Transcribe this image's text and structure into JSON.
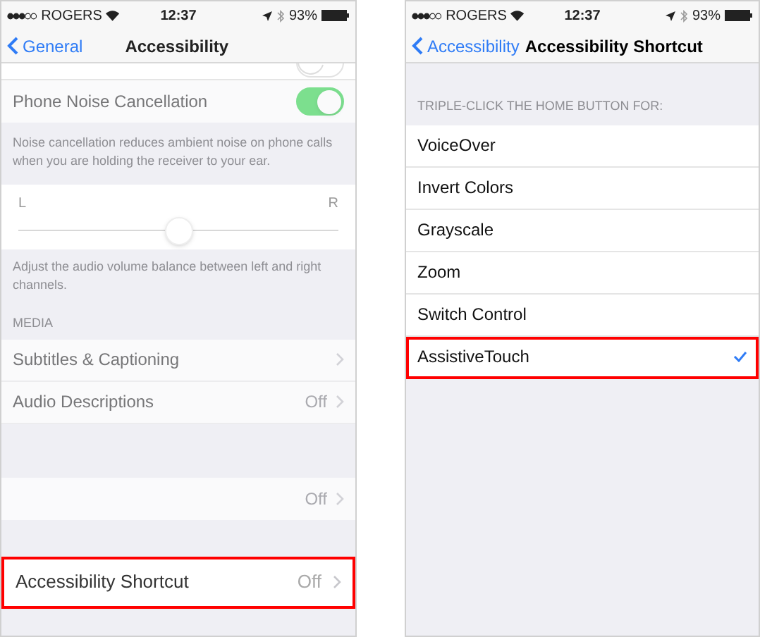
{
  "left_screen": {
    "status_bar": {
      "carrier": "ROGERS",
      "time": "12:37",
      "battery": "93%"
    },
    "nav": {
      "back": "General",
      "title": "Accessibility"
    },
    "cut_row": {
      "on": false
    },
    "noise_row": {
      "label": "Phone Noise Cancellation",
      "on": true
    },
    "noise_footer": "Noise cancellation reduces ambient noise on phone calls when you are holding the receiver to your ear.",
    "balance": {
      "left": "L",
      "right": "R",
      "level": 0.5
    },
    "balance_footer": "Adjust the audio volume balance between left and right channels.",
    "media_header": "MEDIA",
    "media_rows": [
      {
        "label": "Subtitles & Captioning"
      },
      {
        "label": "Audio Descriptions",
        "value": "Off"
      }
    ],
    "hidden_row": {
      "value": "Off"
    },
    "shortcut_row": {
      "label": "Accessibility Shortcut",
      "value": "Off",
      "highlighted": true
    }
  },
  "right_screen": {
    "status_bar": {
      "carrier": "ROGERS",
      "time": "12:37",
      "battery": "93%"
    },
    "nav": {
      "back": "Accessibility",
      "title": "Accessibility Shortcut"
    },
    "header": "TRIPLE-CLICK THE HOME BUTTON FOR:",
    "options": [
      {
        "label": "VoiceOver",
        "selected": false,
        "highlighted": false
      },
      {
        "label": "Invert Colors",
        "selected": false,
        "highlighted": false
      },
      {
        "label": "Grayscale",
        "selected": false,
        "highlighted": false
      },
      {
        "label": "Zoom",
        "selected": false,
        "highlighted": false
      },
      {
        "label": "Switch Control",
        "selected": false,
        "highlighted": false
      },
      {
        "label": "AssistiveTouch",
        "selected": true,
        "highlighted": true
      }
    ]
  }
}
